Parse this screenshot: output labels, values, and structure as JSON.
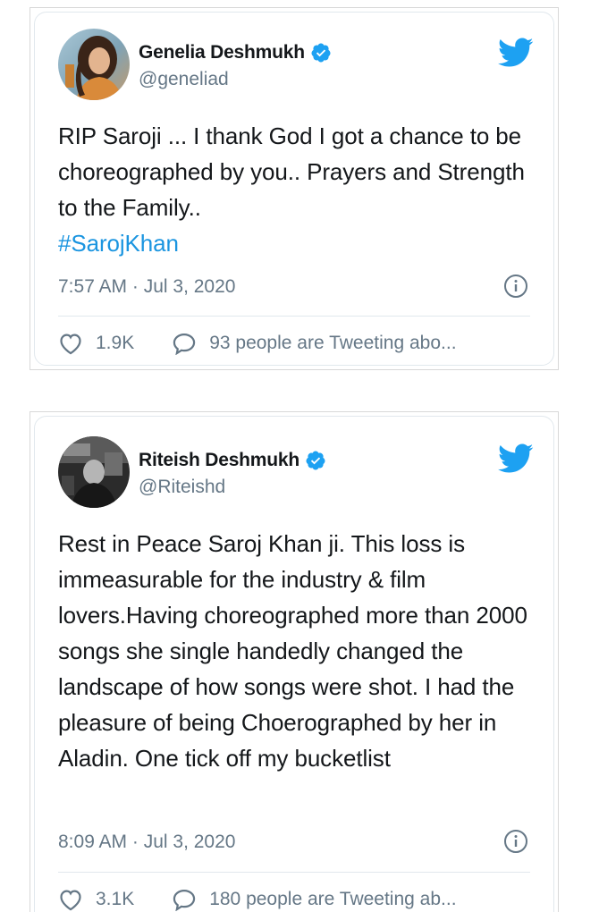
{
  "tweets": [
    {
      "author": {
        "name": "Genelia Deshmukh",
        "handle": "@geneliad"
      },
      "text": "RIP Saroji ... I thank God I got a chance to be choreographed by you.. Prayers and Strength to the Family..",
      "hashtag": "#SarojKhan",
      "timestamp": "7:57 AM · Jul 3, 2020",
      "likes": "1.9K",
      "conversation": "93 people are Tweeting abo..."
    },
    {
      "author": {
        "name": "Riteish Deshmukh",
        "handle": "@Riteishd"
      },
      "text": "Rest in Peace Saroj Khan ji. This loss is immeasurable for the industry & film lovers.Having choreographed more than 2000 songs she single handedly changed the landscape of how songs were shot. I had the pleasure of being Choerographed by her in Aladin. One tick off my bucketlist",
      "timestamp": "8:09 AM · Jul 3, 2020",
      "likes": "3.1K",
      "conversation": "180 people are Tweeting ab..."
    }
  ],
  "colors": {
    "twitter_blue": "#1da1f2",
    "hashtag": "#1b95e0",
    "text": "#14171a",
    "secondary": "#657786",
    "border": "#e1e8ed"
  },
  "icons": [
    "twitter-bird-icon",
    "verified-badge-icon",
    "info-icon",
    "heart-icon",
    "speech-bubble-icon"
  ]
}
